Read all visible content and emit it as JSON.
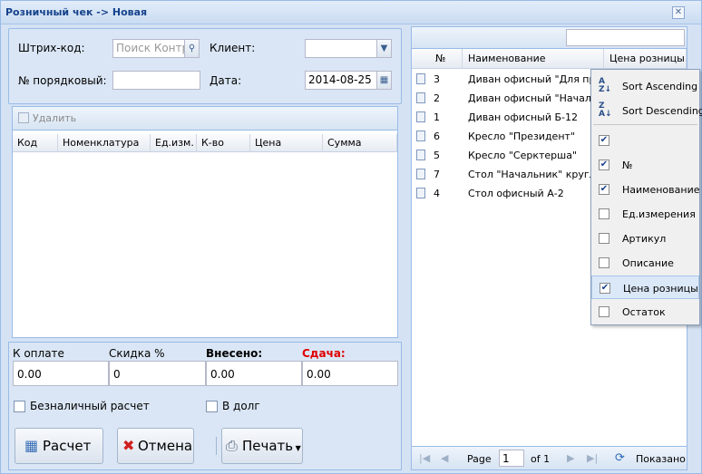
{
  "window": {
    "title": "Розничный чек -> Новая"
  },
  "form": {
    "barcode_label": "Штрих-код:",
    "barcode_placeholder": "Поиск Контр",
    "client_label": "Клиент:",
    "client_value": "",
    "number_label": "№ порядковый:",
    "number_value": "",
    "date_label": "Дата:",
    "date_value": "2014-08-25"
  },
  "lines": {
    "delete_label": "Удалить",
    "columns": [
      "Код",
      "Номенклатура",
      "Ед.изм.",
      "К-во",
      "Цена",
      "Сумма"
    ]
  },
  "totals": {
    "to_pay_label": "К оплате",
    "discount_label": "Скидка %",
    "paid_label": "Внесено:",
    "change_label": "Сдача:",
    "to_pay": "0.00",
    "discount": "0",
    "paid": "0.00",
    "change": "0.00",
    "cashless_label": "Безналичный расчет",
    "debt_label": "В долг"
  },
  "buttons": {
    "calc": "Расчет",
    "cancel": "Отмена",
    "print": "Печать"
  },
  "products": {
    "columns": [
      "№",
      "Наименование",
      "Цена розницы"
    ],
    "rows": [
      {
        "num": "3",
        "name": "Диван офисный \"Для прих..."
      },
      {
        "num": "2",
        "name": "Диван офисный \"Началь..."
      },
      {
        "num": "1",
        "name": "Диван офисный Б-12"
      },
      {
        "num": "6",
        "name": "Кресло \"Президент\""
      },
      {
        "num": "5",
        "name": "Кресло \"Серктерша\""
      },
      {
        "num": "7",
        "name": "Стол \"Начальник\" круглый"
      },
      {
        "num": "4",
        "name": "Стол офисный А-2"
      }
    ],
    "pager": {
      "page_label": "Page",
      "page_value": "1",
      "of_label": "of 1",
      "shown_label": "Показано"
    }
  },
  "column_menu": {
    "sort_asc": "Sort Ascending",
    "sort_desc": "Sort Descending",
    "items": [
      {
        "label": "",
        "checked": true
      },
      {
        "label": "№",
        "checked": true
      },
      {
        "label": "Наименование",
        "checked": true
      },
      {
        "label": "Ед.измерения",
        "checked": false
      },
      {
        "label": "Артикул",
        "checked": false
      },
      {
        "label": "Описание",
        "checked": false
      },
      {
        "label": "Цена розницы",
        "checked": true
      },
      {
        "label": "Остаток",
        "checked": false
      }
    ]
  }
}
